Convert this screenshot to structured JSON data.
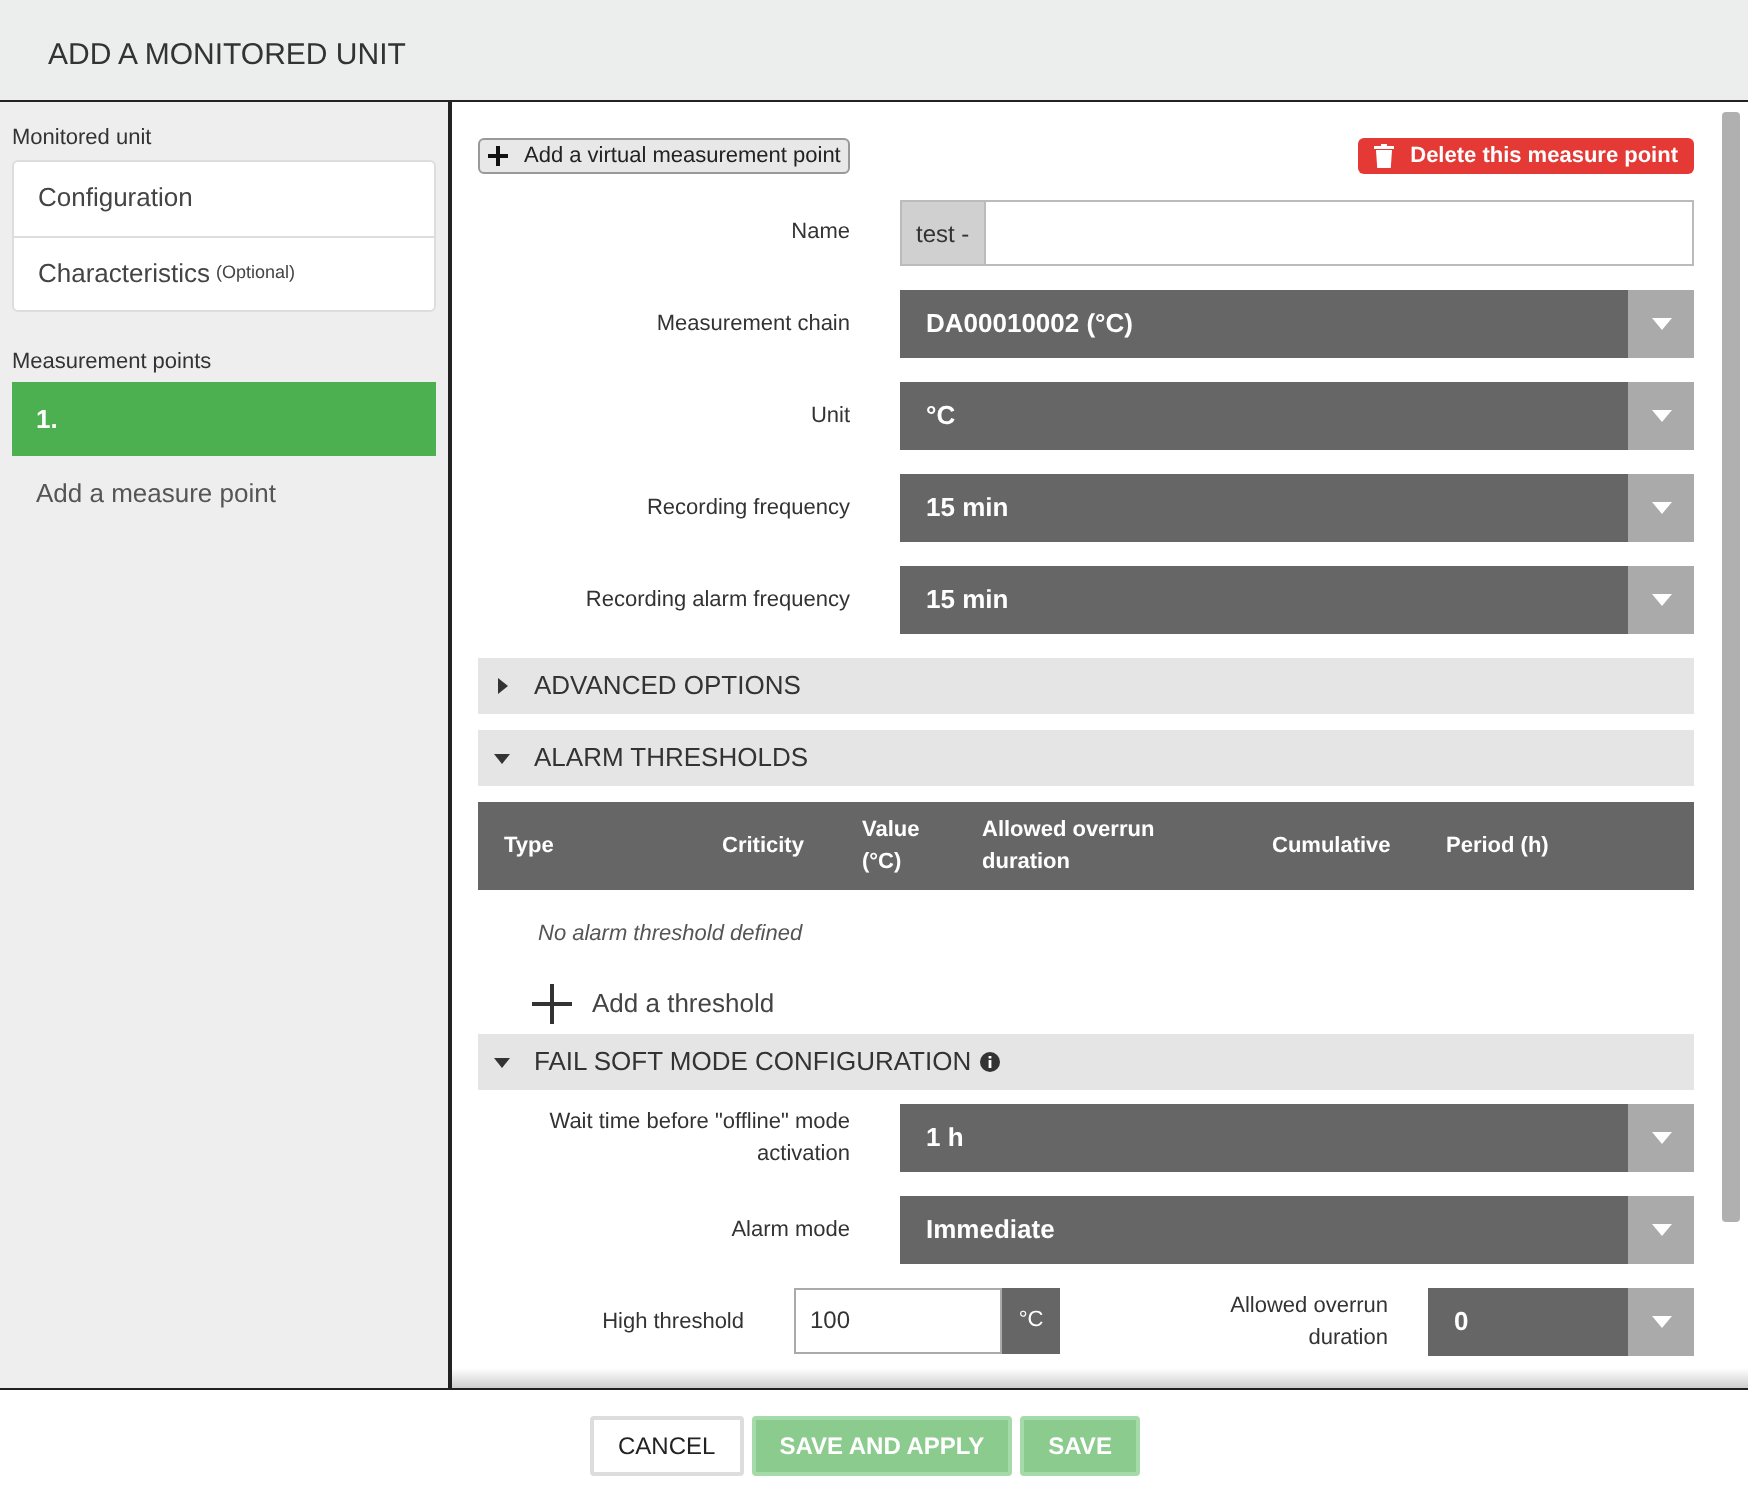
{
  "dialog": {
    "title": "ADD A MONITORED UNIT"
  },
  "sidebar": {
    "groups": [
      {
        "heading": "Monitored unit",
        "items": [
          {
            "label": "Configuration",
            "selected": false
          },
          {
            "label": "Characteristics",
            "note": "(Optional)",
            "selected": false
          }
        ]
      },
      {
        "heading": "Measurement points",
        "items": [
          {
            "label": "1.",
            "selected": true
          }
        ]
      }
    ],
    "add_link": "Add a measure point"
  },
  "toolbar": {
    "add_virtual": "Add a virtual measurement point",
    "delete": "Delete this measure point"
  },
  "fields": [
    {
      "kind": "prefixed",
      "label": "Name",
      "prefix": "test -"
    },
    {
      "kind": "select",
      "label": "Measurement chain",
      "value": "DA00010002 (°C)"
    },
    {
      "kind": "select",
      "label": "Unit",
      "value": "°C"
    },
    {
      "kind": "select",
      "label": "Recording frequency",
      "value": "15 min"
    },
    {
      "kind": "select",
      "label": "Recording alarm frequency",
      "value": "15 min"
    }
  ],
  "sections": [
    {
      "title": "ADVANCED OPTIONS",
      "expanded": false
    },
    {
      "title": "ALARM THRESHOLDS",
      "expanded": true
    }
  ],
  "threshold_table": {
    "columns": [
      "Type",
      "Criticity",
      "Value (°C)",
      "Allowed overrun duration",
      "Cumulative",
      "Period (h)"
    ],
    "empty": "No alarm threshold defined",
    "add": "Add a threshold"
  },
  "fail_soft": {
    "title": "FAIL SOFT MODE CONFIGURATION",
    "expanded": true,
    "info": true,
    "fields": [
      {
        "label": "Wait time before \"offline\" mode activation",
        "value": "1 h"
      },
      {
        "label": "Alarm mode",
        "value": "Immediate"
      }
    ],
    "high_threshold": {
      "label": "High threshold",
      "value": "100",
      "unit": "°C"
    },
    "overrun": {
      "label": "Allowed overrun duration",
      "value": "0"
    }
  },
  "buttons": [
    {
      "label": "CANCEL",
      "kind": "secondary",
      "disabled": false
    },
    {
      "label": "SAVE AND APPLY",
      "kind": "primary",
      "disabled": true
    },
    {
      "label": "SAVE",
      "kind": "primary",
      "disabled": true
    }
  ]
}
